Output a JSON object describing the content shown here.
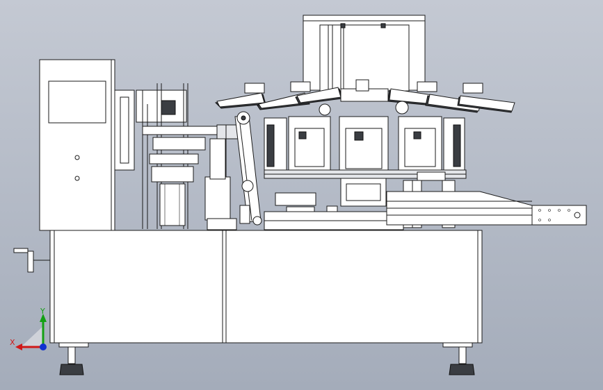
{
  "viewport": {
    "background_top": "#c4c9d3",
    "background_bottom": "#a4acba"
  },
  "triad": {
    "x_label": "X",
    "y_label": "Y",
    "x_color": "#d01818",
    "y_color": "#13a013",
    "z_color": "#1030d0"
  }
}
